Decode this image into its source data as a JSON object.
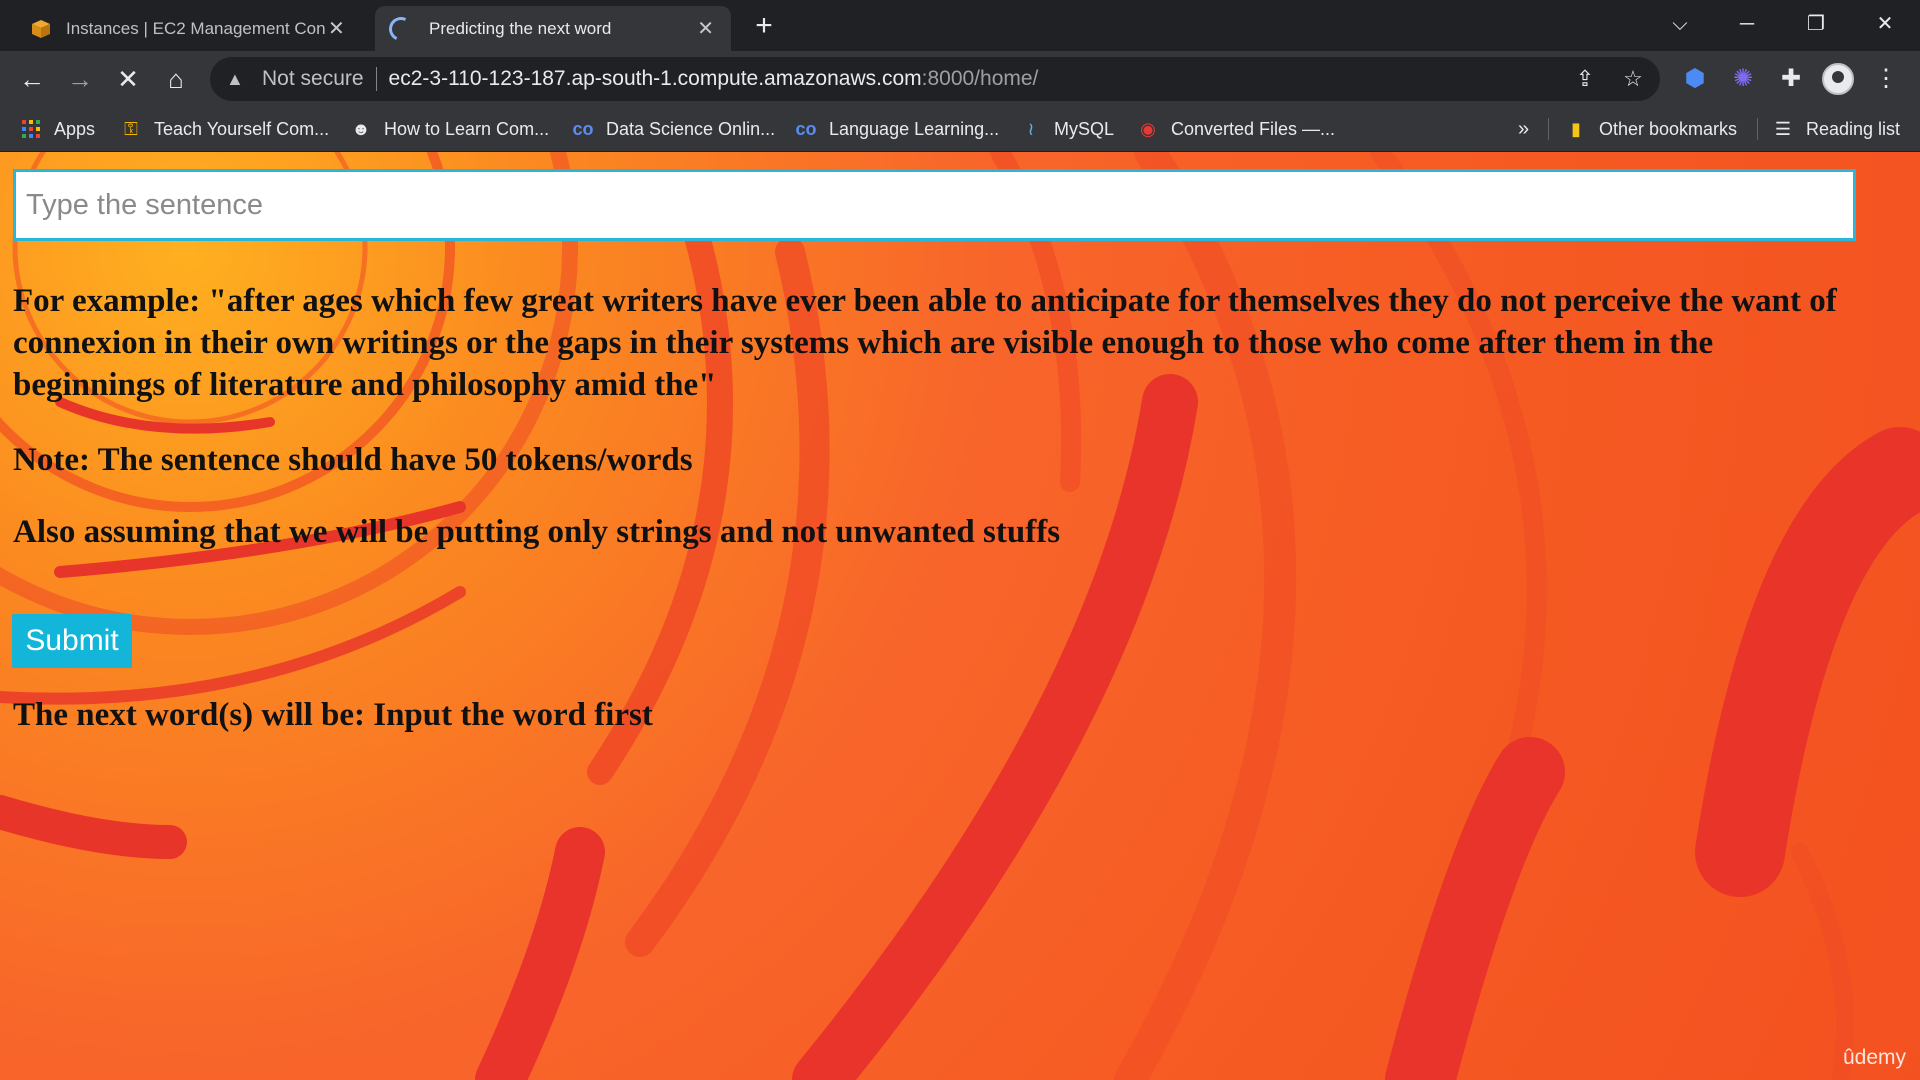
{
  "browser": {
    "tabs": [
      {
        "title": "Instances | EC2 Management Console",
        "close": "✕"
      },
      {
        "title": "Predicting the next word",
        "close": "✕"
      }
    ],
    "new_tab": "+",
    "window_controls": {
      "dropdown": "⌵",
      "minimize": "─",
      "restore": "❐",
      "close": "✕"
    },
    "security_label": "Not secure",
    "url_host": "ec2-3-110-123-187.ap-south-1.compute.amazonaws.com",
    "url_rest": ":8000/home/",
    "bookmarks": [
      {
        "label": "Apps",
        "icon": "apps-grid-icon"
      },
      {
        "label": "Teach Yourself Com...",
        "icon": "key-icon"
      },
      {
        "label": "How to Learn Com...",
        "icon": "robot-icon"
      },
      {
        "label": "Data Science Onlin...",
        "icon": "coursera-icon"
      },
      {
        "label": "Language Learning...",
        "icon": "coursera-icon"
      },
      {
        "label": "MySQL",
        "icon": "mysql-icon"
      },
      {
        "label": "Converted Files —...",
        "icon": "converter-icon"
      }
    ],
    "overflow": "»",
    "other_bookmarks": "Other bookmarks",
    "reading_list": "Reading list",
    "accent": "#8ab4f8"
  },
  "page": {
    "input_placeholder": "Type the sentence",
    "input_value": "",
    "example_text": "For example: \"after ages which few great writers have ever been able to anticipate for themselves they do not perceive the want of connexion in their own writings or the gaps in their systems which are visible enough to those who come after them in the beginnings of literature and philosophy amid the\"",
    "note_text": "Note: The sentence should have 50 tokens/words",
    "assume_text": "Also assuming that we will be putting only strings and not unwanted stuffs",
    "submit_label": "Submit",
    "result_text": "The next word(s) will be: Input the word first",
    "watermark": "ûdemy",
    "colors": {
      "background": "#f55a22",
      "input_border": "#29b6d9",
      "button": "#13b5d8"
    }
  }
}
